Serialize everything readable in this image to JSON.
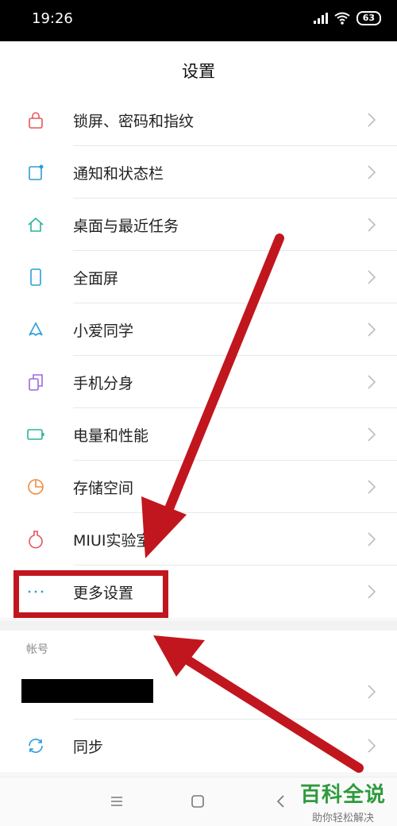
{
  "status_bar": {
    "time": "19:26",
    "battery": "63"
  },
  "header": {
    "title": "设置"
  },
  "menu": [
    {
      "label": "锁屏、密码和指纹",
      "icon": "lock-icon",
      "color": "#e8575c"
    },
    {
      "label": "通知和状态栏",
      "icon": "notification-icon",
      "color": "#2b9ed8"
    },
    {
      "label": "桌面与最近任务",
      "icon": "home-icon",
      "color": "#2ab39b"
    },
    {
      "label": "全面屏",
      "icon": "phone-icon",
      "color": "#2b9ed8"
    },
    {
      "label": "小爱同学",
      "icon": "xiaoai-icon",
      "color": "#2b9ed8"
    },
    {
      "label": "手机分身",
      "icon": "dual-icon",
      "color": "#9b6bd9"
    },
    {
      "label": "电量和性能",
      "icon": "battery-icon",
      "color": "#2ab39b"
    },
    {
      "label": "存储空间",
      "icon": "storage-icon",
      "color": "#ef8c3b"
    },
    {
      "label": "MIUI实验室",
      "icon": "flask-icon",
      "color": "#e8575c"
    },
    {
      "label": "更多设置",
      "icon": "more-icon",
      "color": "#2b9ed8"
    }
  ],
  "account_section": {
    "title": "帐号",
    "sync_label": "同步"
  },
  "watermark": {
    "title": "百科全说",
    "subtitle": "助你轻松解决"
  },
  "colors": {
    "annotation": "#c1161e",
    "watermark": "#2e9b3d"
  }
}
